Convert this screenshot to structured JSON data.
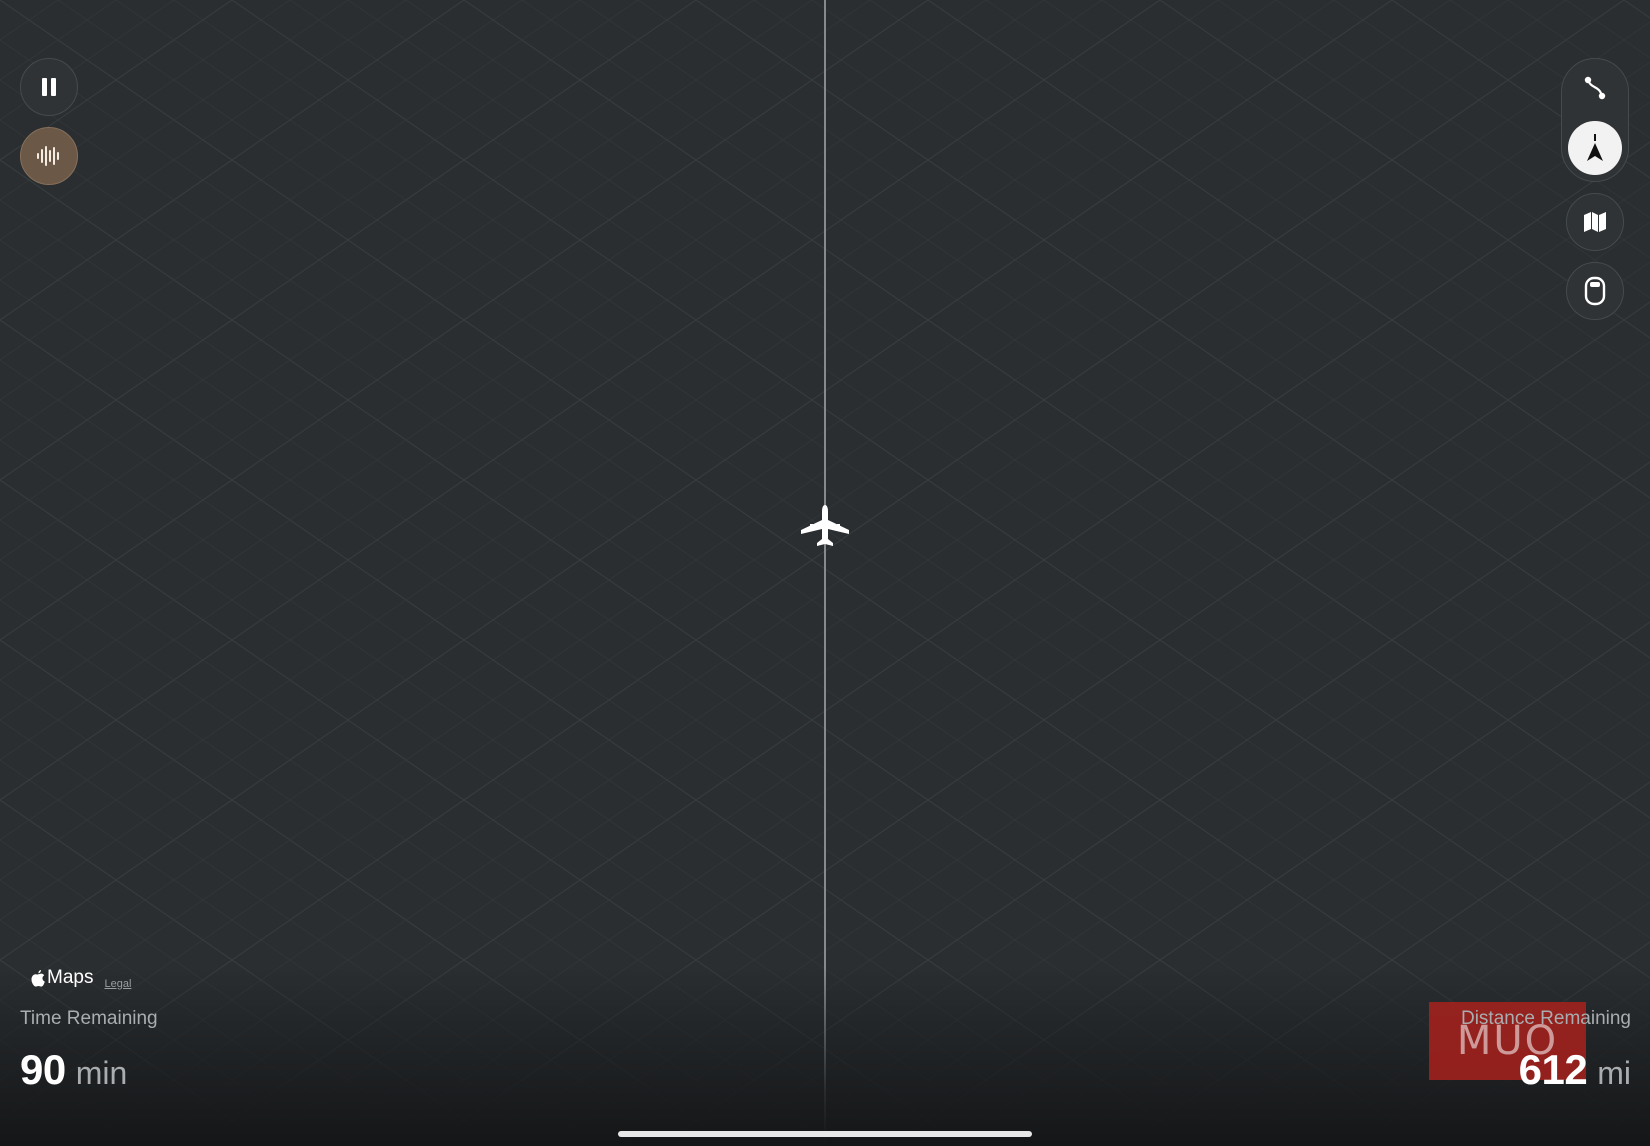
{
  "map": {
    "background": "#2a2e30",
    "grid_color": "#3a3f41",
    "route_line_color": "#9da1a3"
  },
  "controls": {
    "left": [
      {
        "name": "pause-button",
        "icon": "pause-icon"
      },
      {
        "name": "audio-button",
        "icon": "waveform-icon",
        "accent": "#6b5846"
      }
    ],
    "right": [
      {
        "name": "route-button",
        "icon": "route-icon"
      },
      {
        "name": "follow-button",
        "icon": "location-arrow-icon",
        "active": true
      },
      {
        "name": "map-style-button",
        "icon": "map-icon"
      },
      {
        "name": "window-view-button",
        "icon": "airplane-window-icon"
      }
    ]
  },
  "aircraft": {
    "icon": "airplane-icon"
  },
  "attribution": {
    "brand": "Maps",
    "legal": "Legal"
  },
  "time_remaining": {
    "label": "Time Remaining",
    "value": "90",
    "unit": "min"
  },
  "distance_remaining": {
    "label": "Distance Remaining",
    "value": "612",
    "unit": "mi"
  },
  "watermark": {
    "text": "MUO",
    "color": "#b0201c"
  }
}
